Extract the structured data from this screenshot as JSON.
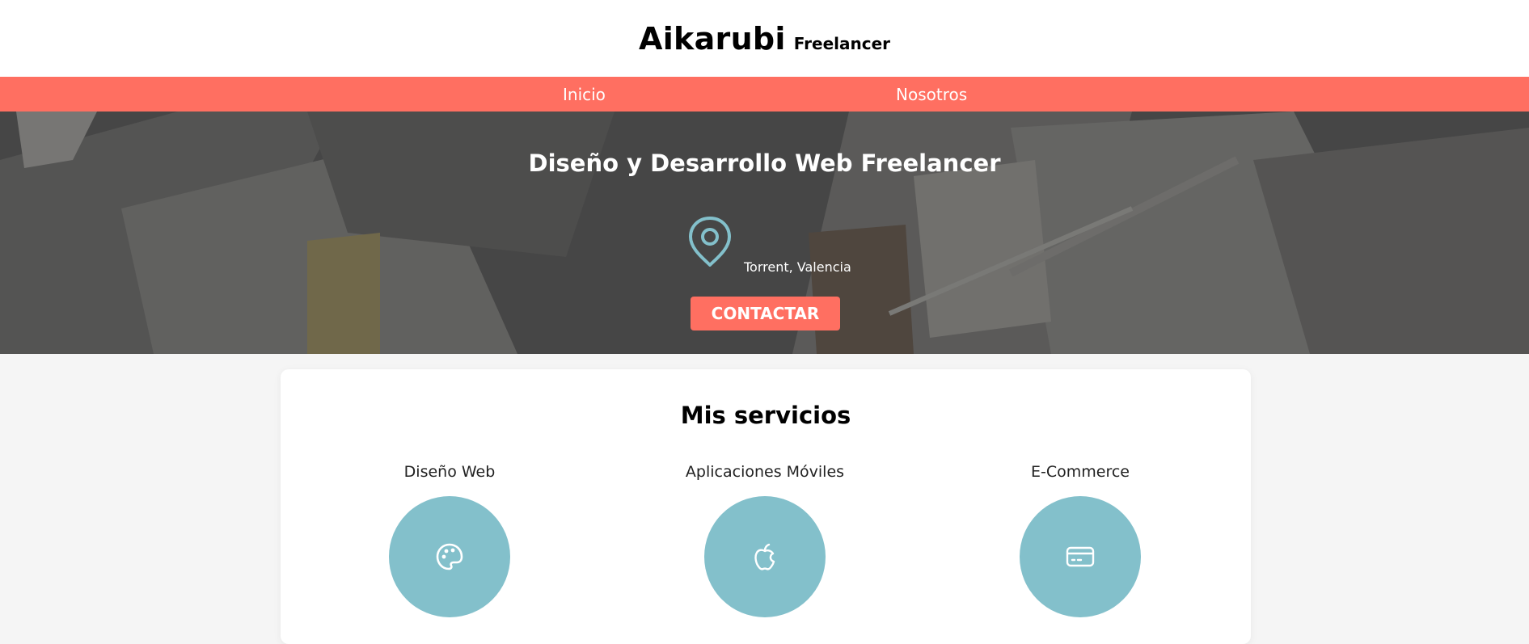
{
  "header": {
    "brand_name": "Aikarubi",
    "brand_tag": "Freelancer"
  },
  "nav": {
    "items": [
      {
        "label": "Inicio"
      },
      {
        "label": "Nosotros"
      }
    ]
  },
  "hero": {
    "title": "Diseño y Desarrollo Web Freelancer",
    "location_icon": "map-pin-icon",
    "location": "Torrent, Valencia",
    "cta_label": "CONTACTAR"
  },
  "services": {
    "title": "Mis servicios",
    "items": [
      {
        "label": "Diseño Web",
        "icon": "palette-icon"
      },
      {
        "label": "Aplicaciones Móviles",
        "icon": "apple-icon"
      },
      {
        "label": "E-Commerce",
        "icon": "credit-card-icon"
      }
    ]
  },
  "colors": {
    "accent": "#ff6f61",
    "service_circle": "#83c0cb",
    "location_icon": "#83c0cb"
  }
}
